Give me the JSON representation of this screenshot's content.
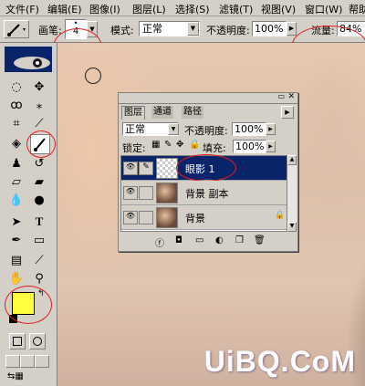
{
  "menu": [
    "文件(F)",
    "编辑(E)",
    "图像(I)",
    "图层(L)",
    "选择(S)",
    "滤镜(T)",
    "视图(V)",
    "窗口(W)",
    "帮助"
  ],
  "options": {
    "brush_label": "画笔:",
    "brush_size": "4",
    "mode_label": "模式:",
    "mode_value": "正常",
    "opacity_label": "不透明度:",
    "opacity_value": "100%",
    "flow_label": "流量:",
    "flow_value": "84%"
  },
  "colors": {
    "foreground": "#ffff40",
    "background": "#ffffff",
    "accent_circle": "#e02020",
    "selection": "#0a246a"
  },
  "layers_panel": {
    "tabs": [
      "图层",
      "通道",
      "路径"
    ],
    "blend_mode": "正常",
    "opacity_label": "不透明度:",
    "opacity_value": "100%",
    "lock_label": "锁定:",
    "fill_label": "填充:",
    "fill_value": "100%",
    "layers": [
      {
        "name": "眼影 1",
        "selected": true,
        "thumb": "transparent"
      },
      {
        "name": "背景 副本",
        "selected": false,
        "thumb": "photo"
      },
      {
        "name": "背景",
        "selected": false,
        "thumb": "photo",
        "locked": true
      }
    ]
  },
  "watermark": "UiBQ.CoM"
}
